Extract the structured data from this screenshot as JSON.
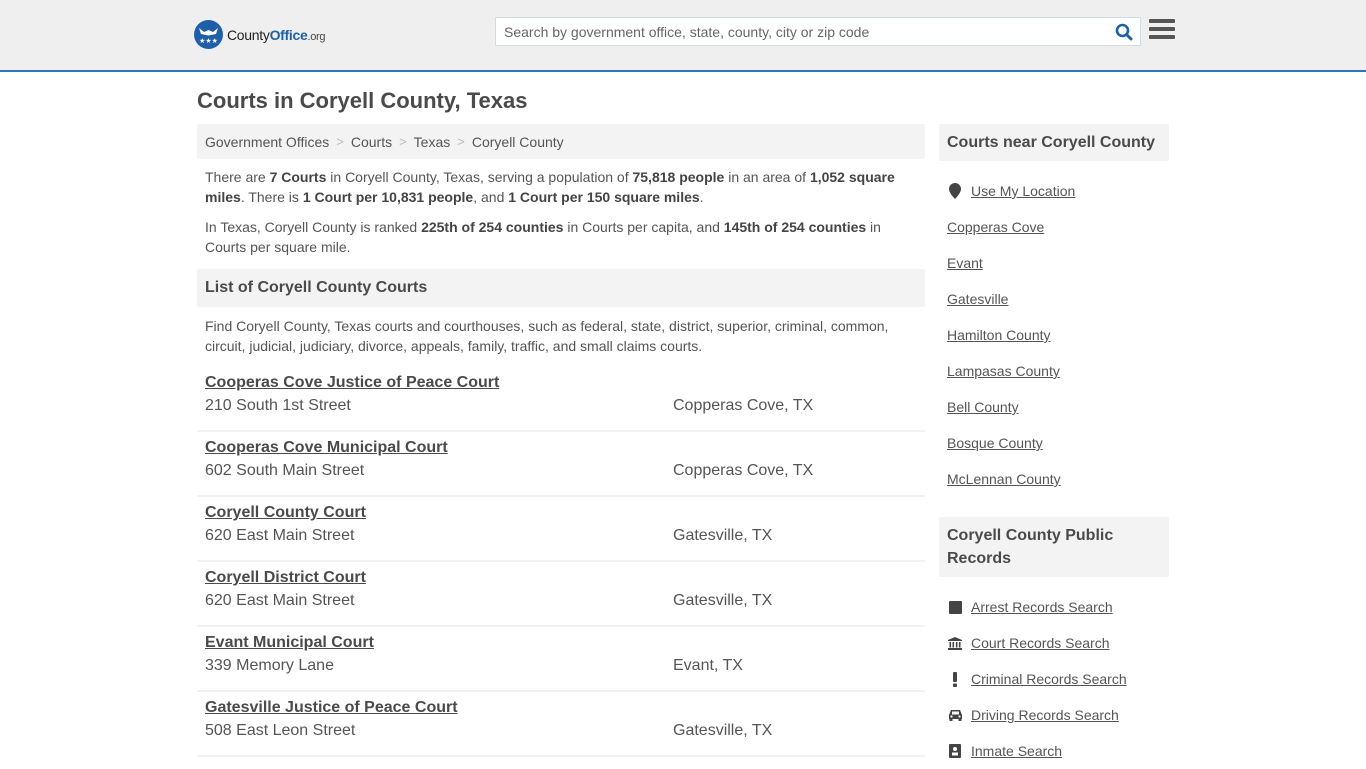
{
  "header": {
    "logo": {
      "name": "County",
      "brand": "Office",
      "tld": ".org"
    },
    "search": {
      "placeholder": "Search by government office, state, county, city or zip code",
      "value": ""
    }
  },
  "page": {
    "title": "Courts in Coryell County, Texas"
  },
  "breadcrumb": [
    "Government Offices",
    "Courts",
    "Texas",
    "Coryell County"
  ],
  "intro": {
    "p1": {
      "t1": "There are ",
      "b1": "7 Courts",
      "t2": " in Coryell County, Texas, serving a population of ",
      "b2": "75,818 people",
      "t3": " in an area of ",
      "b3": "1,052 square miles",
      "t4": ". There is ",
      "b4": "1 Court per 10,831 people",
      "t5": ", and ",
      "b5": "1 Court per 150 square miles",
      "t6": "."
    },
    "p2": {
      "t1": "In Texas, Coryell County is ranked ",
      "b1": "225th of 254 counties",
      "t2": " in Courts per capita, and ",
      "b2": "145th of 254 counties",
      "t3": " in Courts per square mile."
    }
  },
  "list": {
    "heading": "List of Coryell County Courts",
    "description": "Find Coryell County, Texas courts and courthouses, such as federal, state, district, superior, criminal, common, circuit, judicial, judiciary, divorce, appeals, family, traffic, and small claims courts.",
    "courts": [
      {
        "name": "Cooperas Cove Justice of Peace Court",
        "address": "210 South 1st Street",
        "city": "Copperas Cove, TX"
      },
      {
        "name": "Cooperas Cove Municipal Court",
        "address": "602 South Main Street",
        "city": "Copperas Cove, TX"
      },
      {
        "name": "Coryell County Court",
        "address": "620 East Main Street",
        "city": "Gatesville, TX"
      },
      {
        "name": "Coryell District Court",
        "address": "620 East Main Street",
        "city": "Gatesville, TX"
      },
      {
        "name": "Evant Municipal Court",
        "address": "339 Memory Lane",
        "city": "Evant, TX"
      },
      {
        "name": "Gatesville Justice of Peace Court",
        "address": "508 East Leon Street",
        "city": "Gatesville, TX"
      }
    ]
  },
  "sidebar": {
    "nearby": {
      "heading": "Courts near Coryell County",
      "use_location": "Use My Location",
      "items": [
        "Copperas Cove",
        "Evant",
        "Gatesville",
        "Hamilton County",
        "Lampasas County",
        "Bell County",
        "Bosque County",
        "McLennan County"
      ]
    },
    "records": {
      "heading": "Coryell County Public Records",
      "items": [
        {
          "label": "Arrest Records Search",
          "icon": "square-icon"
        },
        {
          "label": "Court Records Search",
          "icon": "courthouse-icon"
        },
        {
          "label": "Criminal Records Search",
          "icon": "exclamation-icon"
        },
        {
          "label": "Driving Records Search",
          "icon": "car-icon"
        },
        {
          "label": "Inmate Search",
          "icon": "id-badge-icon"
        }
      ]
    }
  },
  "colors": {
    "accent": "#2f76b6",
    "brand": "#1f5fa8",
    "text": "#555555",
    "panel": "#f3f3f3"
  }
}
